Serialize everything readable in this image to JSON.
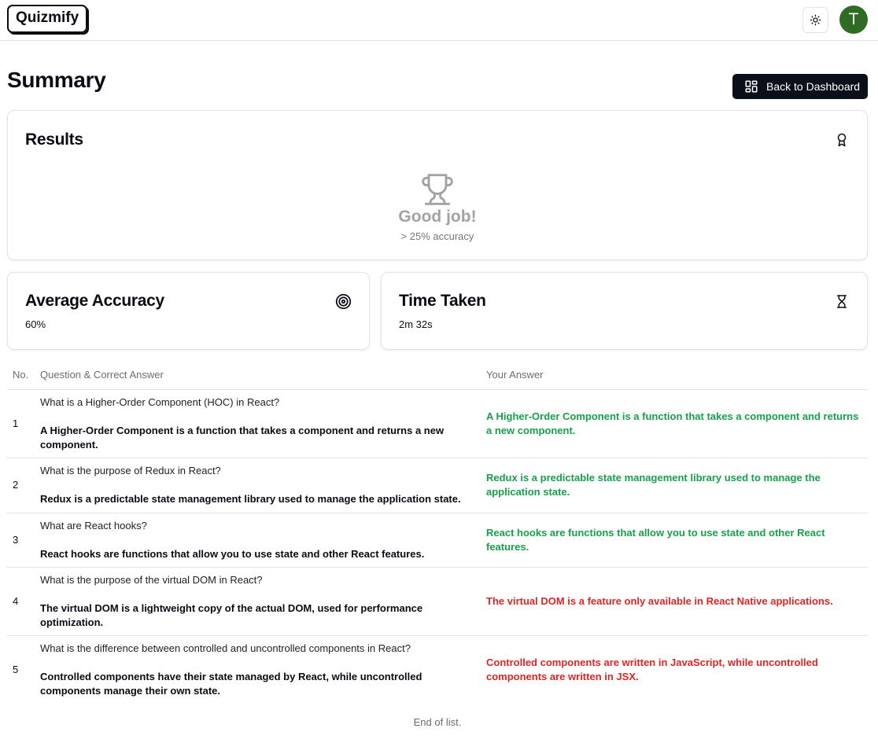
{
  "app": {
    "name": "Quizmify"
  },
  "header": {
    "avatar_letter": "T"
  },
  "page": {
    "title": "Summary",
    "back_button_label": "Back to Dashboard"
  },
  "results": {
    "title": "Results",
    "message": "Good job!",
    "note": "> 25% accuracy"
  },
  "accuracy": {
    "title": "Average Accuracy",
    "value": "60%"
  },
  "time": {
    "title": "Time Taken",
    "value": "2m 32s"
  },
  "table": {
    "headers": {
      "no": "No.",
      "question": "Question & Correct Answer",
      "answer": "Your Answer"
    },
    "rows": [
      {
        "no": "1",
        "question": "What is a Higher-Order Component (HOC) in React?",
        "correct_answer": "A Higher-Order Component is a function that takes a component and returns a new component.",
        "your_answer": "A Higher-Order Component is a function that takes a component and returns a new component.",
        "is_correct": true
      },
      {
        "no": "2",
        "question": "What is the purpose of Redux in React?",
        "correct_answer": "Redux is a predictable state management library used to manage the application state.",
        "your_answer": "Redux is a predictable state management library used to manage the application state.",
        "is_correct": true
      },
      {
        "no": "3",
        "question": "What are React hooks?",
        "correct_answer": "React hooks are functions that allow you to use state and other React features.",
        "your_answer": "React hooks are functions that allow you to use state and other React features.",
        "is_correct": true
      },
      {
        "no": "4",
        "question": "What is the purpose of the virtual DOM in React?",
        "correct_answer": "The virtual DOM is a lightweight copy of the actual DOM, used for performance optimization.",
        "your_answer": "The virtual DOM is a feature only available in React Native applications.",
        "is_correct": false
      },
      {
        "no": "5",
        "question": "What is the difference between controlled and uncontrolled components in React?",
        "correct_answer": "Controlled components have their state managed by React, while uncontrolled components manage their own state.",
        "your_answer": "Controlled components are written in JavaScript, while uncontrolled components are written in JSX.",
        "is_correct": false
      }
    ]
  },
  "footer": {
    "end_text": "End of list."
  },
  "colors": {
    "correct": "#17a04a",
    "wrong": "#dc2626",
    "avatar": "#2f6b22",
    "primary_button": "#0b0f1a"
  },
  "icons": {
    "theme": "sun-icon",
    "back": "layout-grid-icon",
    "results": "award-icon",
    "trophy": "trophy-icon",
    "accuracy": "target-icon",
    "time": "hourglass-icon"
  }
}
